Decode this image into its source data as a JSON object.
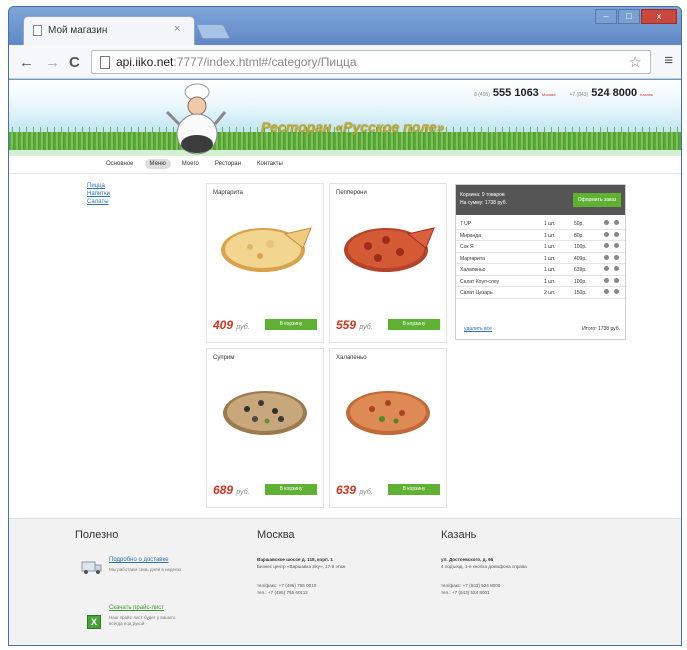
{
  "browser": {
    "tab_title": "Мой магазин",
    "tab_close": "×",
    "url_host": "api.iiko.net",
    "url_rest": ":7777/index.html#/category/Пицца",
    "back": "←",
    "forward": "→",
    "reload": "C",
    "star": "☆",
    "menu": "≡",
    "minimize": "–",
    "maximize": "□",
    "close": "x"
  },
  "site": {
    "name": "Ресторан «Русское поле»",
    "phones": [
      {
        "code": "8 (495)",
        "number": "555 1063",
        "city": "Москва"
      },
      {
        "code": "+7 (843)",
        "number": "524 8000",
        "city": "Казань"
      }
    ],
    "nav": [
      "Основное",
      "Меню",
      "Моего",
      "Ресторан",
      "Контакты"
    ],
    "nav_active": 1
  },
  "sidebar": {
    "links": [
      "Пицца",
      "Напитки",
      "Салаты"
    ]
  },
  "products": [
    {
      "name": "Маргарита",
      "price": "409",
      "currency": "руб.",
      "button": "В корзину",
      "style": "cheese"
    },
    {
      "name": "Пепперони",
      "price": "559",
      "currency": "руб.",
      "button": "В корзину",
      "style": "pepperoni"
    },
    {
      "name": "Суприм",
      "price": "689",
      "currency": "руб.",
      "button": "В корзину",
      "style": "supreme"
    },
    {
      "name": "Халапеньо",
      "price": "639",
      "currency": "руб.",
      "button": "В корзину",
      "style": "jalapeno"
    }
  ],
  "cart": {
    "summary_line1": "Корзина: 9 товаров",
    "summary_line2": "На сумму: 1738 руб.",
    "checkout": "Оформить заказ",
    "items": [
      {
        "name": "7 UP",
        "qty": "1 шт.",
        "price": "50р."
      },
      {
        "name": "Миранда",
        "qty": "1 шт.",
        "price": "80р."
      },
      {
        "name": "Сок Я",
        "qty": "1 шт.",
        "price": "100р."
      },
      {
        "name": "Маргарита",
        "qty": "1 шт.",
        "price": "409р."
      },
      {
        "name": "Халапеньо",
        "qty": "1 шт.",
        "price": "639р."
      },
      {
        "name": "Салат Коул-слоу",
        "qty": "1 шт.",
        "price": "100р."
      },
      {
        "name": "Салат Цезарь",
        "qty": "2 шт.",
        "price": "150р."
      }
    ],
    "clear": "удалить все",
    "total": "Итого: 1738 руб."
  },
  "footer": {
    "col1_title": "Полезно",
    "delivery_link": "Подробно о доставке",
    "delivery_note": "Мы работаем семь дней в неделю",
    "price_link": "Скачать прайс-лист",
    "price_note_1": "Наш прайс-лист будет у вашего",
    "price_note_2": "всегда под рукой",
    "col2_title": "Москва",
    "msk_address": "Варшавское шоссе д. 118, корп. 1",
    "msk_center": "Бизнес центр «Варшавка Sky», 17-й этаж",
    "msk_phone1": "тел/факс: +7 (495) 755 0010",
    "msk_phone2": "тел.: +7 (495) 755 60112",
    "col3_title": "Казань",
    "kzn_address": "ул. Достоевского, д. 66",
    "kzn_note": "4 подъезд, 1-я кнопка домофона справа",
    "kzn_phone1": "тел/факс: +7 (843) 524 8000",
    "kzn_phone2": "тел.: +7 (843) 524 8001"
  }
}
